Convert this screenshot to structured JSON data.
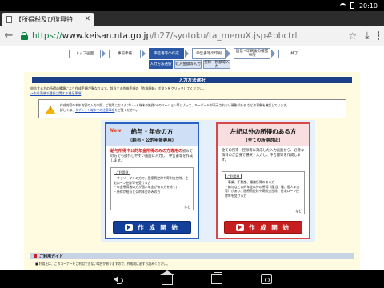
{
  "status_bar": {
    "time": "20:10"
  },
  "browser": {
    "tab_title": "【所得税及び復興特",
    "url": {
      "scheme": "https://",
      "host": "www.keisan.nta.go.jp",
      "path": "/h27/syotoku/ta_menuX.jsp#bbctrl"
    },
    "icons": [
      "back-icon",
      "lock-icon",
      "star-icon",
      "download-icon",
      "menu-icon"
    ]
  },
  "steps": {
    "main": [
      "トップ画面",
      "事前準備",
      "申告書等の作成",
      "申告書等の印刷",
      "送信・印刷後の確認事項",
      "終了"
    ],
    "sub": [
      "入力方法選択",
      "収入金額等入力",
      "控除・税額等入力"
    ]
  },
  "page": {
    "heading": "入力方法選択",
    "intro": "申告する方の所得の種類により作成手順が異なります。該当する作成手順の「作成開始」ボタンをクリックしてください。",
    "intro_link": "→作成手順の選択に関する補足事項",
    "notice_text": "本年内容の入力の際、ご利用になるタブレット端末の推奨OSのバージョン等によって、キーボードが表示されない現象がある などの事象を確認しています。",
    "notice_text2": "詳しくは、",
    "notice_link": "タブレット端末での注意事項",
    "notice_tail": "をご覧ください。",
    "notice_prefix": "作成内容の",
    "guide_title": "ご利用ガイド",
    "guide_text": "■ 利用上は、このコーナーをご利用できない場合がありますので、作成前に必ずお読みください。"
  },
  "cards": {
    "salary": {
      "badge": "New",
      "title": "給与・年金の方",
      "subtitle": "（給与・公的年金専用）",
      "desc_em": "給与所得や公的年金所得のみの方専用の",
      "desc": "初めての方でも操作しやすい画面に入力し、申告書等を作成します。",
      "example_label": "ご利用例",
      "examples": [
        "・サラリーマンの方で、医療費控除や寄附金控除、住宅ローン控除等を受ける方",
        "・年金所得者の方が個人年金がある方を除く)",
        "・所得が給与と公的年金のみの方"
      ],
      "example_tail": "など",
      "button": "作 成 開 始"
    },
    "other": {
      "title": "左記以外の所得のある方",
      "subtitle": "（全ての所得対応）",
      "desc": "全ての所得・控除等に対応した入力画面から、必要な項目のご自身で選択・入力し、申告書等を作成します。",
      "example_label": "ご利用例",
      "examples": [
        "・事業、不動産、譲渡所得のある方",
        "・給与など公的年金以外の所得（配当、雑、個人年金等）があり、医療費控除や寄附金控除、住宅ローン控除等を受ける方"
      ],
      "example_tail": "など",
      "button": "作 成 開 始"
    }
  },
  "colors": {
    "brand": "#1b3f88",
    "blue_card": "#2a62c2",
    "red_card": "#d84848",
    "page_bg": "#fffbe0"
  }
}
